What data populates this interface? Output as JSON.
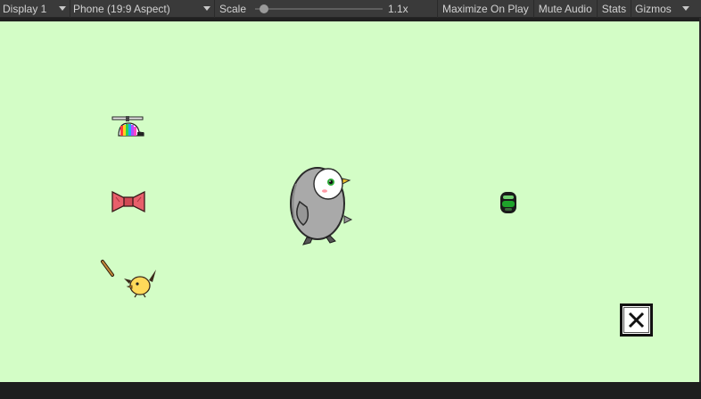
{
  "toolbar": {
    "display": "Display 1",
    "aspect": "Phone (19:9 Aspect)",
    "scale_label": "Scale",
    "scale_value": "1.1x",
    "scale_fraction": 0.07,
    "maximize": "Maximize On Play",
    "mute": "Mute Audio",
    "stats": "Stats",
    "gizmos": "Gizmos"
  },
  "viewport": {
    "background": "#d3fdc6"
  },
  "icons": {
    "propeller_hat": "propeller-hat-icon",
    "bow_tie": "bow-tie-icon",
    "wand": "magic-wand-icon",
    "chick": "yellow-chick-icon",
    "penguin": "penguin-character",
    "orb": "green-orb-icon",
    "close": "close-icon"
  },
  "colors": {
    "toolbar_bg": "#3a3a3a",
    "toolbar_text": "#d2d2d2",
    "penguin_body": "#a9a9a9",
    "bow_red": "#e8606b",
    "orb_green": "#1ea32a"
  }
}
